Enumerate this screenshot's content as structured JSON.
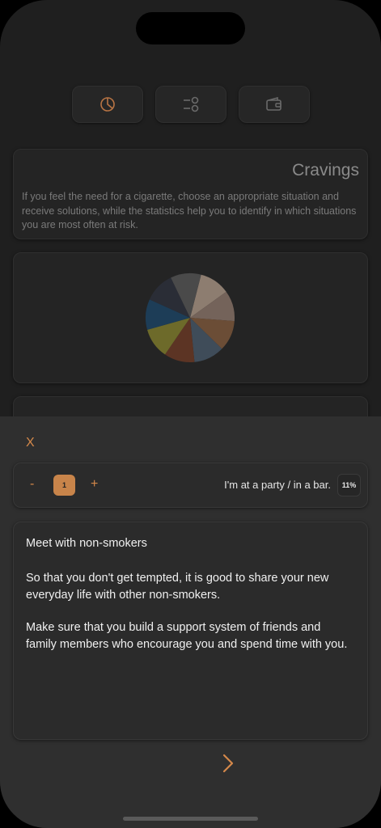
{
  "tabs": [
    {
      "icon": "pie-chart-icon"
    },
    {
      "icon": "sliders-check-icon"
    },
    {
      "icon": "wallet-icon"
    }
  ],
  "info": {
    "title": "Cravings",
    "text": "If you feel the need for a cigarette, choose an appropriate situation and receive solutions, while the statistics help you to identify in which situations you are most often at risk."
  },
  "pie_slices": [
    {
      "color": "#8d7d70",
      "value": 12.5
    },
    {
      "color": "#74635a",
      "value": 12.5
    },
    {
      "color": "#6b4d36",
      "value": 12.5
    },
    {
      "color": "#3f4c59",
      "value": 12.5
    },
    {
      "color": "#5c3424",
      "value": 12.5
    },
    {
      "color": "#6d6a2a",
      "value": 12.5
    },
    {
      "color": "#1d3d57",
      "value": 12.5
    },
    {
      "color": "#2a2d36",
      "value": 12.5
    },
    {
      "color": "#4a4a4a",
      "value": 12.5
    }
  ],
  "sheet": {
    "close_label": "X",
    "minus_label": "-",
    "count": "1",
    "plus_label": "+",
    "situation": "I'm at a party / in a bar.",
    "percent": "11%",
    "tip_title": "Meet with non-smokers",
    "tip_p1": "So that you don't get tempted, it is good to share your new everyday life with other non-smokers.",
    "tip_p2": "Make sure that you build a support system of friends and family members who encourage you and spend time with you.",
    "next_icon": "chevron-right-icon"
  },
  "accent": "#d4884a"
}
